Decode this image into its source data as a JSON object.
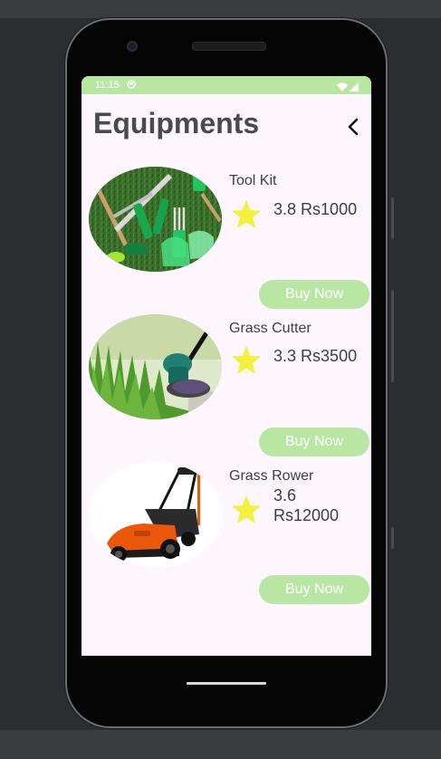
{
  "status": {
    "time": "11:15"
  },
  "header": {
    "title": "Equipments"
  },
  "products": [
    {
      "name": "Tool Kit",
      "rating": "3.8",
      "price": "Rs1000",
      "buy_label": "Buy Now"
    },
    {
      "name": "Grass Cutter",
      "rating": "3.3",
      "price": "Rs3500",
      "buy_label": "Buy Now"
    },
    {
      "name": "Grass Rower",
      "rating": "3.6",
      "price": "Rs12000",
      "buy_label": "Buy Now"
    }
  ],
  "colors": {
    "accent": "#b9e6a2",
    "star": "#f2f13f",
    "background": "#fdf6fd",
    "text": "#4a4a4a"
  }
}
